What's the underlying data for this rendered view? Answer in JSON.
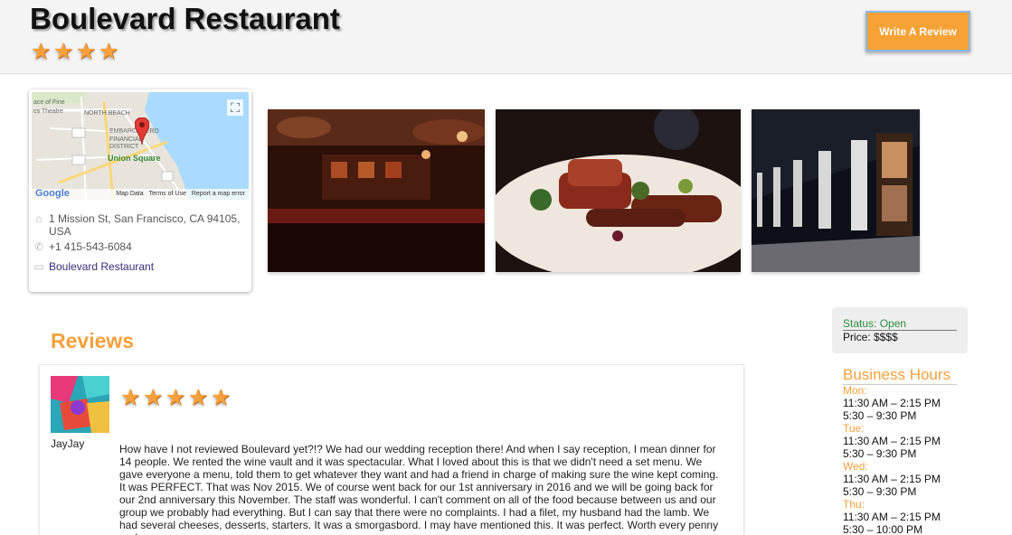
{
  "restaurant": {
    "name": "Boulevard Restaurant",
    "rating": 4,
    "write_review_label": "Write A Review"
  },
  "map": {
    "labels": [
      "ace of Fine",
      "cs Theatre",
      "NORTH BEACH",
      "EMBARCADERO",
      "FINANCIAL",
      "DISTRICT",
      "Union Square"
    ],
    "google_logo": "Google",
    "footer_links": [
      "Map Data",
      "Terms of Use",
      "Report a map error"
    ]
  },
  "info": {
    "address": "1 Mission St, San Francisco, CA 94105, USA",
    "phone": "+1 415-543-6084",
    "website": "Boulevard Restaurant"
  },
  "photos": [
    {
      "subject": "restaurant bar interior"
    },
    {
      "subject": "plated lamb dish"
    },
    {
      "subject": "building exterior at night"
    }
  ],
  "reviews": {
    "heading": "Reviews",
    "items": [
      {
        "author": "JayJay",
        "rating": 5,
        "text": "How have I not reviewed Boulevard yet?!? We had our wedding reception there! And when I say reception, I mean dinner for 14 people. We rented the wine vault and it was spectacular. What I loved about this is that we didn't need a set menu. We gave everyone a menu, told them to get whatever they want and had a friend in charge of making sure the wine kept coming. It was PERFECT. That was Nov 2015. We of course went back for our 1st anniversary in 2016 and we will be going back for our 2nd anniversary this November. The staff was wonderful. I can't comment on all of the food because between us and our group we probably had everything. But I can say that there were no complaints. I had a filet, my husband had the lamb. We had several cheeses, desserts, starters. It was a smorgasbord. I may have mentioned this. It was perfect. Worth every penny and"
      }
    ]
  },
  "status": {
    "status_text": "Status: Open",
    "price_text": "Price: $$$$"
  },
  "hours": {
    "heading": "Business Hours",
    "days": [
      {
        "day": "Mon:",
        "times": [
          "11:30 AM – 2:15 PM",
          "5:30 – 9:30 PM"
        ]
      },
      {
        "day": "Tue:",
        "times": [
          "11:30 AM – 2:15 PM",
          "5:30 – 9:30 PM"
        ]
      },
      {
        "day": "Wed:",
        "times": [
          "11:30 AM – 2:15 PM",
          "5:30 – 9:30 PM"
        ]
      },
      {
        "day": "Thu:",
        "times": [
          "11:30 AM – 2:15 PM",
          "5:30 – 10:00 PM"
        ]
      }
    ]
  },
  "colors": {
    "accent_orange": "#f7a03b",
    "status_green": "#2b8a3e",
    "link_purple": "#3b2b7a"
  }
}
